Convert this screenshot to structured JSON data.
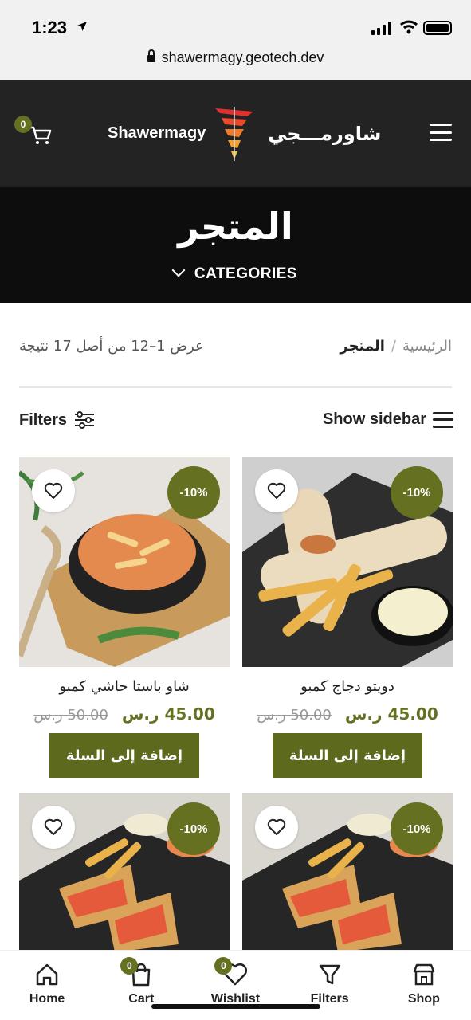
{
  "status_bar": {
    "time": "1:23",
    "url": "shawermagy.geotech.dev"
  },
  "header": {
    "brand_en": "Shawermagy",
    "brand_ar": "شاورمـــجي",
    "cart_count": "0",
    "icons": [
      "cart-icon",
      "logo-icon",
      "menu-icon"
    ]
  },
  "hero": {
    "title": "المتجر",
    "categories_label": "CATEGORIES"
  },
  "breadcrumb": {
    "home": "الرئيسية",
    "separator": "/",
    "current": "المتجر"
  },
  "result_count": "عرض 1–12 من أصل 17 نتيجة",
  "toolbar": {
    "filters_label": "Filters",
    "sidebar_label": "Show sidebar"
  },
  "colors": {
    "accent": "#667021",
    "header_bg": "#232323",
    "hero_bg": "#0d0d0d"
  },
  "products": [
    {
      "name": "دويتو دجاج كمبو",
      "discount": "-10%",
      "old_price": "50.00 ر.س",
      "price": "45.00 ر.س",
      "add_label": "إضافة إلى السلة"
    },
    {
      "name": "شاو باستا حاشي كمبو",
      "discount": "-10%",
      "old_price": "50.00 ر.س",
      "price": "45.00 ر.س",
      "add_label": "إضافة إلى السلة"
    },
    {
      "discount": "-10%"
    },
    {
      "discount": "-10%"
    }
  ],
  "bottom_nav": {
    "home": "Home",
    "cart": "Cart",
    "cart_count": "0",
    "wishlist": "Wishlist",
    "wishlist_count": "0",
    "filters": "Filters",
    "shop": "Shop"
  }
}
